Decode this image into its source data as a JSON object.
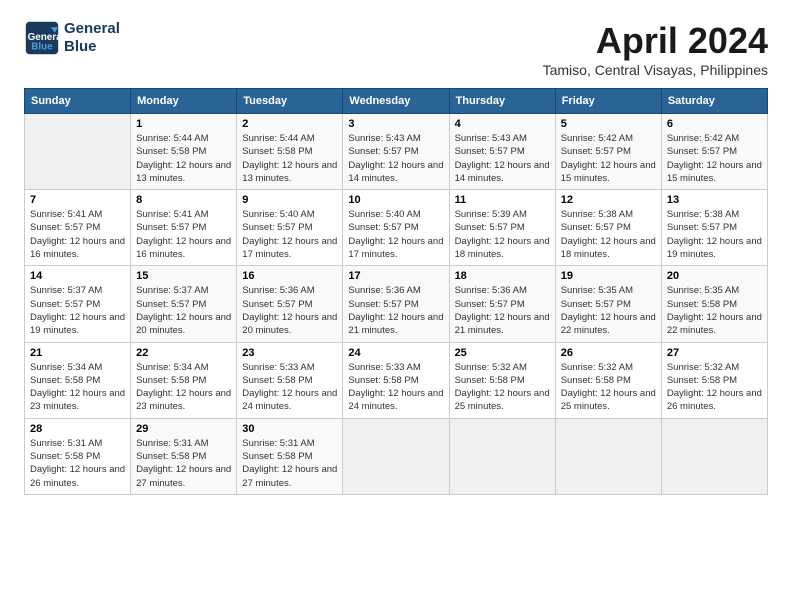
{
  "header": {
    "logo_line1": "General",
    "logo_line2": "Blue",
    "month_year": "April 2024",
    "location": "Tamiso, Central Visayas, Philippines"
  },
  "weekdays": [
    "Sunday",
    "Monday",
    "Tuesday",
    "Wednesday",
    "Thursday",
    "Friday",
    "Saturday"
  ],
  "weeks": [
    [
      {
        "day": "",
        "sunrise": "",
        "sunset": "",
        "daylight": ""
      },
      {
        "day": "1",
        "sunrise": "Sunrise: 5:44 AM",
        "sunset": "Sunset: 5:58 PM",
        "daylight": "Daylight: 12 hours and 13 minutes."
      },
      {
        "day": "2",
        "sunrise": "Sunrise: 5:44 AM",
        "sunset": "Sunset: 5:58 PM",
        "daylight": "Daylight: 12 hours and 13 minutes."
      },
      {
        "day": "3",
        "sunrise": "Sunrise: 5:43 AM",
        "sunset": "Sunset: 5:57 PM",
        "daylight": "Daylight: 12 hours and 14 minutes."
      },
      {
        "day": "4",
        "sunrise": "Sunrise: 5:43 AM",
        "sunset": "Sunset: 5:57 PM",
        "daylight": "Daylight: 12 hours and 14 minutes."
      },
      {
        "day": "5",
        "sunrise": "Sunrise: 5:42 AM",
        "sunset": "Sunset: 5:57 PM",
        "daylight": "Daylight: 12 hours and 15 minutes."
      },
      {
        "day": "6",
        "sunrise": "Sunrise: 5:42 AM",
        "sunset": "Sunset: 5:57 PM",
        "daylight": "Daylight: 12 hours and 15 minutes."
      }
    ],
    [
      {
        "day": "7",
        "sunrise": "Sunrise: 5:41 AM",
        "sunset": "Sunset: 5:57 PM",
        "daylight": "Daylight: 12 hours and 16 minutes."
      },
      {
        "day": "8",
        "sunrise": "Sunrise: 5:41 AM",
        "sunset": "Sunset: 5:57 PM",
        "daylight": "Daylight: 12 hours and 16 minutes."
      },
      {
        "day": "9",
        "sunrise": "Sunrise: 5:40 AM",
        "sunset": "Sunset: 5:57 PM",
        "daylight": "Daylight: 12 hours and 17 minutes."
      },
      {
        "day": "10",
        "sunrise": "Sunrise: 5:40 AM",
        "sunset": "Sunset: 5:57 PM",
        "daylight": "Daylight: 12 hours and 17 minutes."
      },
      {
        "day": "11",
        "sunrise": "Sunrise: 5:39 AM",
        "sunset": "Sunset: 5:57 PM",
        "daylight": "Daylight: 12 hours and 18 minutes."
      },
      {
        "day": "12",
        "sunrise": "Sunrise: 5:38 AM",
        "sunset": "Sunset: 5:57 PM",
        "daylight": "Daylight: 12 hours and 18 minutes."
      },
      {
        "day": "13",
        "sunrise": "Sunrise: 5:38 AM",
        "sunset": "Sunset: 5:57 PM",
        "daylight": "Daylight: 12 hours and 19 minutes."
      }
    ],
    [
      {
        "day": "14",
        "sunrise": "Sunrise: 5:37 AM",
        "sunset": "Sunset: 5:57 PM",
        "daylight": "Daylight: 12 hours and 19 minutes."
      },
      {
        "day": "15",
        "sunrise": "Sunrise: 5:37 AM",
        "sunset": "Sunset: 5:57 PM",
        "daylight": "Daylight: 12 hours and 20 minutes."
      },
      {
        "day": "16",
        "sunrise": "Sunrise: 5:36 AM",
        "sunset": "Sunset: 5:57 PM",
        "daylight": "Daylight: 12 hours and 20 minutes."
      },
      {
        "day": "17",
        "sunrise": "Sunrise: 5:36 AM",
        "sunset": "Sunset: 5:57 PM",
        "daylight": "Daylight: 12 hours and 21 minutes."
      },
      {
        "day": "18",
        "sunrise": "Sunrise: 5:36 AM",
        "sunset": "Sunset: 5:57 PM",
        "daylight": "Daylight: 12 hours and 21 minutes."
      },
      {
        "day": "19",
        "sunrise": "Sunrise: 5:35 AM",
        "sunset": "Sunset: 5:57 PM",
        "daylight": "Daylight: 12 hours and 22 minutes."
      },
      {
        "day": "20",
        "sunrise": "Sunrise: 5:35 AM",
        "sunset": "Sunset: 5:58 PM",
        "daylight": "Daylight: 12 hours and 22 minutes."
      }
    ],
    [
      {
        "day": "21",
        "sunrise": "Sunrise: 5:34 AM",
        "sunset": "Sunset: 5:58 PM",
        "daylight": "Daylight: 12 hours and 23 minutes."
      },
      {
        "day": "22",
        "sunrise": "Sunrise: 5:34 AM",
        "sunset": "Sunset: 5:58 PM",
        "daylight": "Daylight: 12 hours and 23 minutes."
      },
      {
        "day": "23",
        "sunrise": "Sunrise: 5:33 AM",
        "sunset": "Sunset: 5:58 PM",
        "daylight": "Daylight: 12 hours and 24 minutes."
      },
      {
        "day": "24",
        "sunrise": "Sunrise: 5:33 AM",
        "sunset": "Sunset: 5:58 PM",
        "daylight": "Daylight: 12 hours and 24 minutes."
      },
      {
        "day": "25",
        "sunrise": "Sunrise: 5:32 AM",
        "sunset": "Sunset: 5:58 PM",
        "daylight": "Daylight: 12 hours and 25 minutes."
      },
      {
        "day": "26",
        "sunrise": "Sunrise: 5:32 AM",
        "sunset": "Sunset: 5:58 PM",
        "daylight": "Daylight: 12 hours and 25 minutes."
      },
      {
        "day": "27",
        "sunrise": "Sunrise: 5:32 AM",
        "sunset": "Sunset: 5:58 PM",
        "daylight": "Daylight: 12 hours and 26 minutes."
      }
    ],
    [
      {
        "day": "28",
        "sunrise": "Sunrise: 5:31 AM",
        "sunset": "Sunset: 5:58 PM",
        "daylight": "Daylight: 12 hours and 26 minutes."
      },
      {
        "day": "29",
        "sunrise": "Sunrise: 5:31 AM",
        "sunset": "Sunset: 5:58 PM",
        "daylight": "Daylight: 12 hours and 27 minutes."
      },
      {
        "day": "30",
        "sunrise": "Sunrise: 5:31 AM",
        "sunset": "Sunset: 5:58 PM",
        "daylight": "Daylight: 12 hours and 27 minutes."
      },
      {
        "day": "",
        "sunrise": "",
        "sunset": "",
        "daylight": ""
      },
      {
        "day": "",
        "sunrise": "",
        "sunset": "",
        "daylight": ""
      },
      {
        "day": "",
        "sunrise": "",
        "sunset": "",
        "daylight": ""
      },
      {
        "day": "",
        "sunrise": "",
        "sunset": "",
        "daylight": ""
      }
    ]
  ]
}
